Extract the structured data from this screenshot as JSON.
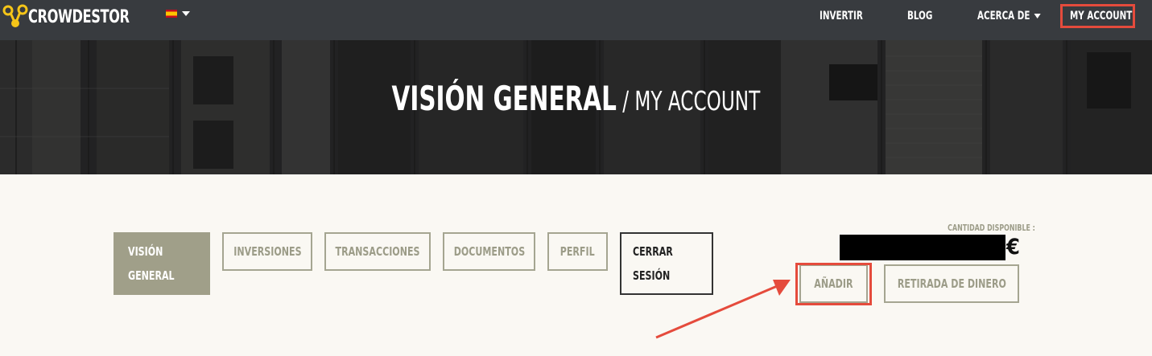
{
  "header": {
    "brand": "CROWDESTOR",
    "language": {
      "flag": "spain-flag-icon",
      "label": ""
    },
    "nav": [
      {
        "label": "INVERTIR",
        "dropdown": false
      },
      {
        "label": "BLOG",
        "dropdown": false
      },
      {
        "label": "ACERCA DE",
        "dropdown": true
      },
      {
        "label": "MY ACCOUNT",
        "dropdown": false,
        "highlighted": true
      }
    ]
  },
  "hero": {
    "title": "VISIÓN GENERAL",
    "separator": " / ",
    "subtitle": "MY ACCOUNT"
  },
  "tabs": [
    {
      "label": "VISIÓN GENERAL",
      "active": true
    },
    {
      "label": "INVERSIONES"
    },
    {
      "label": "TRANSACCIONES"
    },
    {
      "label": "DOCUMENTOS"
    },
    {
      "label": "PERFIL"
    },
    {
      "label": "CERRAR SESIÓN",
      "style": "dark"
    }
  ],
  "balance": {
    "label": "CANTIDAD DISPONIBLE :",
    "value": "",
    "currency": "€"
  },
  "actions": {
    "add": "AÑADIR",
    "withdraw": "RETIRADA DE DINERO"
  },
  "colors": {
    "topbar": "#383b3f",
    "accent_highlight": "#e54b3c",
    "tab_active": "#a09f89",
    "tab_border": "#a5a591",
    "brand_yellow": "#f5c518"
  }
}
